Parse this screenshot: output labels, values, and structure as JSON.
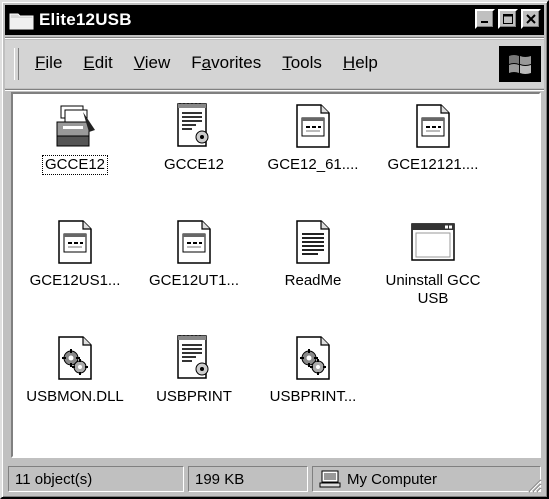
{
  "window": {
    "title": "Elite12USB"
  },
  "title_buttons": {
    "minimize": "minimize-icon",
    "maximize": "maximize-icon",
    "close": "close-icon"
  },
  "menu": [
    {
      "label": "File",
      "accel": "F",
      "rest": "ile"
    },
    {
      "label": "Edit",
      "accel": "E",
      "rest": "dit"
    },
    {
      "label": "View",
      "accel": "V",
      "rest": "iew"
    },
    {
      "label": "Favorites",
      "accel": "a",
      "pre": "F",
      "rest": "vorites"
    },
    {
      "label": "Tools",
      "accel": "T",
      "rest": "ools"
    },
    {
      "label": "Help",
      "accel": "H",
      "rest": "elp"
    }
  ],
  "files": [
    {
      "label": "GCCE12",
      "icon": "printer-folder-icon"
    },
    {
      "label": "GCCE12",
      "icon": "settings-document-icon"
    },
    {
      "label": "GCE12_61....",
      "icon": "application-document-icon"
    },
    {
      "label": "GCE12121....",
      "icon": "application-document-icon"
    },
    {
      "label": "GCE12US1...",
      "icon": "application-document-icon"
    },
    {
      "label": "GCE12UT1...",
      "icon": "application-document-icon"
    },
    {
      "label": "ReadMe",
      "icon": "text-document-icon"
    },
    {
      "label": "Uninstall GCC USB",
      "icon": "program-window-icon"
    },
    {
      "label": "USBMON.DLL",
      "icon": "dll-gear-icon"
    },
    {
      "label": "USBPRINT",
      "icon": "settings-document-icon"
    },
    {
      "label": "USBPRINT...",
      "icon": "dll-gear-icon"
    }
  ],
  "status": {
    "objects": "11 object(s)",
    "size": "199 KB",
    "zone": "My Computer"
  }
}
